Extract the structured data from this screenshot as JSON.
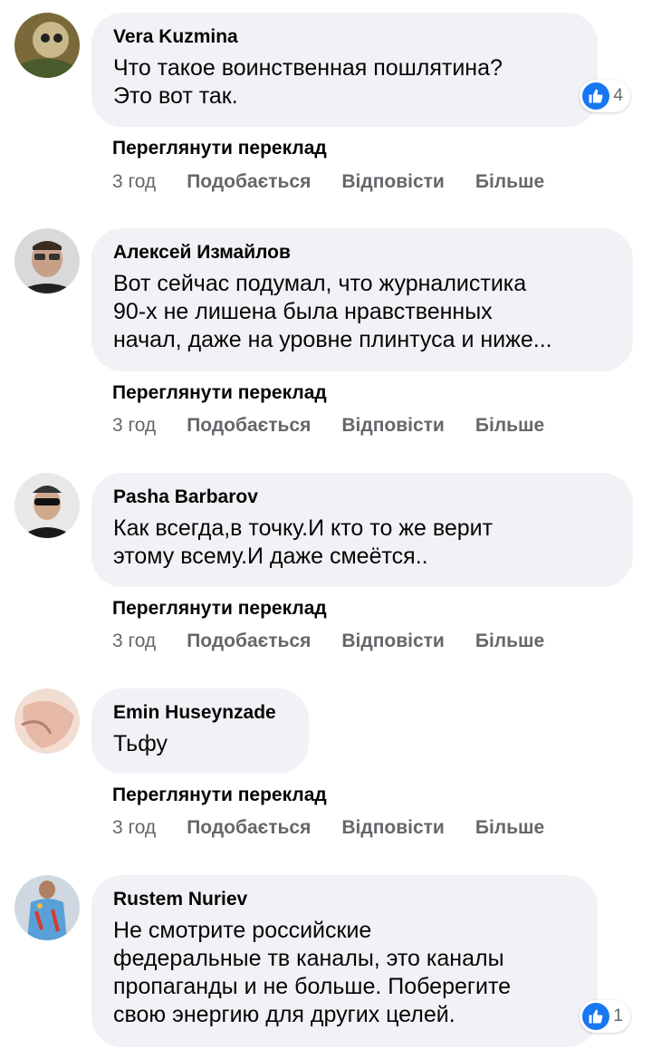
{
  "ui": {
    "translate_label": "Переглянути переклад",
    "like_label": "Подобається",
    "reply_label": "Відповісти",
    "more_label": "Більше"
  },
  "comments": [
    {
      "author": "Vera Kuzmina",
      "text": "Что такое воинственная пошлятина?\nЭто вот так.",
      "time": "3 год",
      "reactions": "4"
    },
    {
      "author": "Алексей Измайлов",
      "text": "Вот сейчас подумал, что журналистика\n90-х не лишена была нравственных\nначал, даже на уровне плинтуса и ниже...",
      "time": "3 год"
    },
    {
      "author": "Pasha Barbarov",
      "text": "Как всегда,в точку.И кто то же верит\nэтому всему.И даже смеётся..",
      "time": "3 год"
    },
    {
      "author": "Emin Huseynzade",
      "text": "Тьфу",
      "time": "3 год"
    },
    {
      "author": "Rustem Nuriev",
      "text": "Не смотрите российские\nфедеральные тв каналы, это каналы\nпропаганды и не больше. Поберегите\nсвою энергию для других целей.",
      "reactions": "1"
    }
  ]
}
